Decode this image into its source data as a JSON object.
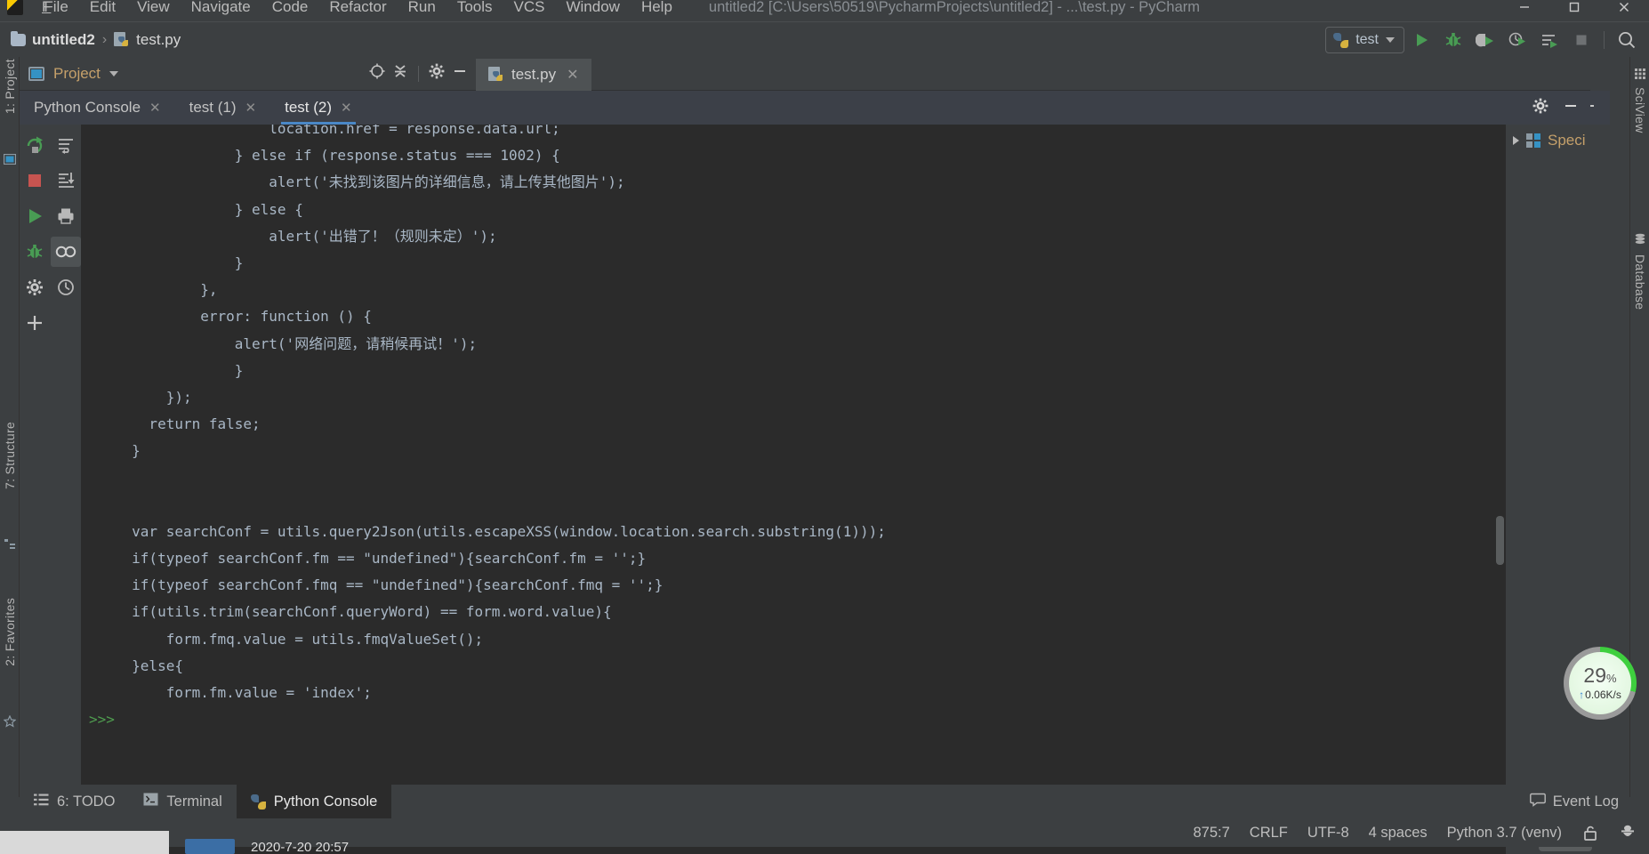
{
  "window": {
    "title": "untitled2 [C:\\Users\\50519\\PycharmProjects\\untitled2] - ...\\test.py - PyCharm",
    "minimize_label": "—",
    "maximize_label": "❐",
    "close_label": "✕"
  },
  "menu": [
    {
      "label": "File",
      "mnemonic": "F"
    },
    {
      "label": "Edit",
      "mnemonic": "E"
    },
    {
      "label": "View",
      "mnemonic": "V"
    },
    {
      "label": "Navigate",
      "mnemonic": "N"
    },
    {
      "label": "Code",
      "mnemonic": "C"
    },
    {
      "label": "Refactor",
      "mnemonic": "R"
    },
    {
      "label": "Run",
      "mnemonic": "u"
    },
    {
      "label": "Tools",
      "mnemonic": "T"
    },
    {
      "label": "VCS",
      "mnemonic": "S"
    },
    {
      "label": "Window",
      "mnemonic": "W"
    },
    {
      "label": "Help",
      "mnemonic": "H"
    }
  ],
  "breadcrumb": {
    "project": "untitled2",
    "separator": "›",
    "file": "test.py"
  },
  "toolbar": {
    "run_config": "test",
    "icons": [
      "run-icon",
      "debug-icon",
      "coverage-icon",
      "profile-icon",
      "run-with-console-icon",
      "stop-icon",
      "search-everywhere-icon"
    ]
  },
  "project_panel": {
    "title": "Project",
    "icons": [
      "locate-target-icon",
      "collapse-all-icon",
      "gear-icon",
      "hide-icon"
    ]
  },
  "editor": {
    "tab_label": "test.py",
    "close_label": "✕"
  },
  "console": {
    "tabs": [
      {
        "label": "Python Console",
        "active": false,
        "close": "✕"
      },
      {
        "label": "test (1)",
        "active": false,
        "close": "✕"
      },
      {
        "label": "test (2)",
        "active": true,
        "close": "✕"
      }
    ],
    "header_icons": [
      "gear-icon",
      "hide-icon"
    ],
    "left_toolbar_a": [
      "rerun-icon",
      "stop-icon",
      "run-icon",
      "debug-icon",
      "settings-icon",
      "add-icon"
    ],
    "left_toolbar_b": [
      "soft-wrap-icon",
      "scroll-to-end-icon",
      "print-icon",
      "show-variables-icon",
      "history-icon"
    ],
    "prompt": ">>>",
    "code_lines": [
      {
        "indent": 21,
        "text": "location.href = response.data.url;"
      },
      {
        "indent": 17,
        "text": "} else if (response.status === 1002) {"
      },
      {
        "indent": 21,
        "text": "alert('未找到该图片的详细信息，请上传其他图片');"
      },
      {
        "indent": 17,
        "text": "} else {"
      },
      {
        "indent": 21,
        "text": "alert('出错了！（规则未定）');"
      },
      {
        "indent": 17,
        "text": "}"
      },
      {
        "indent": 13,
        "text": "},"
      },
      {
        "indent": 13,
        "text": "error: function () {"
      },
      {
        "indent": 17,
        "text": "alert('网络问题，请稍候再试！');"
      },
      {
        "indent": 17,
        "text": "}"
      },
      {
        "indent": 9,
        "text": "});"
      },
      {
        "indent": 7,
        "text": "return false;"
      },
      {
        "indent": 5,
        "text": "}"
      },
      {
        "indent": 0,
        "text": ""
      },
      {
        "indent": 0,
        "text": ""
      },
      {
        "indent": 5,
        "text": "var searchConf = utils.query2Json(utils.escapeXSS(window.location.search.substring(1)));"
      },
      {
        "indent": 5,
        "text": "if(typeof searchConf.fm == \"undefined\"){searchConf.fm = '';}"
      },
      {
        "indent": 5,
        "text": "if(typeof searchConf.fmq == \"undefined\"){searchConf.fmq = '';}"
      },
      {
        "indent": 5,
        "text": "if(utils.trim(searchConf.queryWord) == form.word.value){"
      },
      {
        "indent": 9,
        "text": "form.fmq.value = utils.fmqValueSet();"
      },
      {
        "indent": 5,
        "text": "}else{"
      },
      {
        "indent": 9,
        "text": "form.fm.value = 'index';"
      }
    ]
  },
  "special_vars": {
    "label": "Speci",
    "expand": "▶"
  },
  "left_stripe": [
    {
      "label": "1: Project"
    },
    {
      "label": "7: Structure"
    },
    {
      "label": "2: Favorites"
    }
  ],
  "right_stripe": [
    {
      "label": "SciView",
      "icon": "grid-icon"
    },
    {
      "label": "Database",
      "icon": "database-icon"
    }
  ],
  "bottom_tools": [
    {
      "label": "6: TODO",
      "underline": "6",
      "icon": "todo-icon",
      "active": false
    },
    {
      "label": "Terminal",
      "icon": "terminal-icon",
      "active": false
    },
    {
      "label": "Python Console",
      "icon": "python-icon",
      "active": true
    }
  ],
  "event_log": {
    "label": "Event Log",
    "icon": "balloon-icon"
  },
  "status_bar": {
    "caret": "875:7",
    "line_sep": "CRLF",
    "encoding": "UTF-8",
    "indent": "4 spaces",
    "interpreter": "Python 3.7 (venv)",
    "icons": [
      "lock-icon",
      "hector-icon"
    ]
  },
  "net_widget": {
    "percent": "29",
    "percent_unit": "%",
    "speed": "0.06K/s",
    "arrow": "↑",
    "ring_color": "#3ecf3e"
  },
  "taskbar": {
    "clock": "2020-7-20 20:57"
  },
  "colors": {
    "bg_chrome": "#3c3f41",
    "bg_editor": "#2b2b2b",
    "accent_blue": "#4a88c7",
    "accent_green": "#499c54",
    "text": "#bbbbbb",
    "code_text": "#a9b7c6"
  }
}
